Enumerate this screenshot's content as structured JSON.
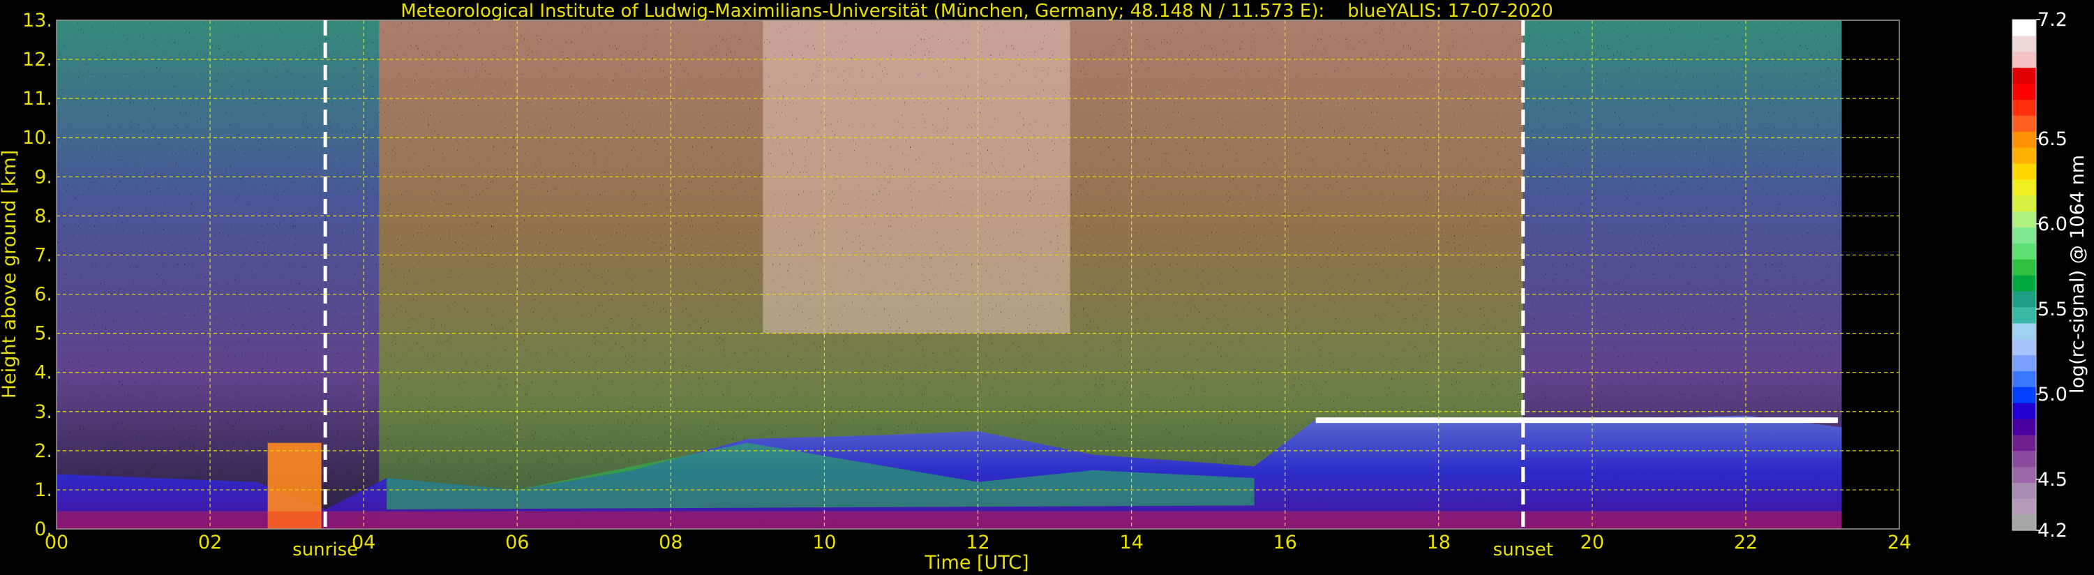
{
  "chart_data": {
    "type": "heatmap",
    "title": "Meteorological Institute of Ludwig-Maximilians-Universität (München, Germany; 48.148 N / 11.573 E):    blueYALIS: 17-07-2020",
    "xlabel": "Time [UTC]",
    "ylabel": "Height above ground [km]",
    "xlim": [
      0,
      24
    ],
    "ylim": [
      0,
      13
    ],
    "x_ticks": [
      "00",
      "02",
      "04",
      "06",
      "08",
      "10",
      "12",
      "14",
      "16",
      "18",
      "20",
      "22",
      "24"
    ],
    "y_ticks": [
      "0.",
      "1.",
      "2.",
      "3.",
      "4.",
      "5.",
      "6.",
      "7.",
      "8.",
      "9.",
      "10.",
      "11.",
      "12.",
      "13."
    ],
    "grid": true,
    "data_end_hour": 23.25,
    "annotations": [
      {
        "label": "sunrise",
        "x": 3.5
      },
      {
        "label": "sunset",
        "x": 19.1
      }
    ],
    "colorbar": {
      "label": "log(rc-signal) @ 1064 nm",
      "range": [
        4.2,
        7.2
      ],
      "ticks": [
        "4.2",
        "4.5",
        "5.0",
        "5.5",
        "6.0",
        "6.5",
        "7.2"
      ],
      "tick_values": [
        4.2,
        4.5,
        5.0,
        5.5,
        6.0,
        6.5,
        7.2
      ],
      "colors": [
        "#a6a6a6",
        "#b79ab9",
        "#a98ab0",
        "#9a66a6",
        "#8a4a9e",
        "#6f1f8f",
        "#4a00a0",
        "#2000d0",
        "#0040ff",
        "#3a78ff",
        "#7aa0ff",
        "#a8c4ff",
        "#9ed0f0",
        "#3ab8a6",
        "#1e9e84",
        "#00a840",
        "#30c040",
        "#60e070",
        "#80e890",
        "#b0f080",
        "#d8f040",
        "#f0f020",
        "#ffd800",
        "#ffb000",
        "#ff9000",
        "#ff6020",
        "#ff3010",
        "#ff0000",
        "#e00000",
        "#f4c0c0",
        "#f0d8d8",
        "#ffffff"
      ]
    }
  }
}
